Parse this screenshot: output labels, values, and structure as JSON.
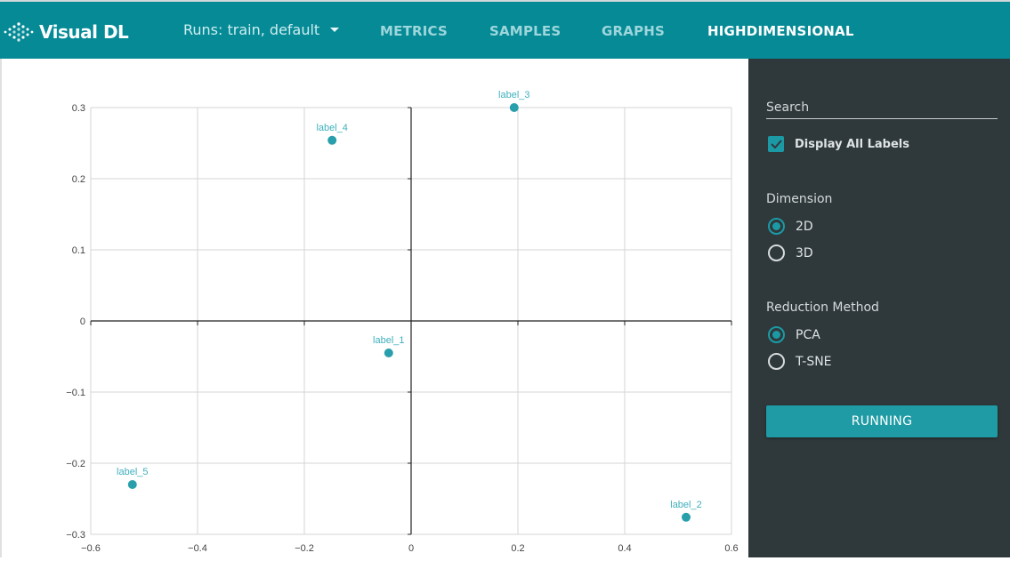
{
  "header": {
    "app_name": "Visual DL",
    "logo_icon": "dotted-diamond-icon",
    "runs_label": "Runs: train, default",
    "runs_icon": "caret-down-icon",
    "nav": [
      {
        "label": "METRICS",
        "active": false
      },
      {
        "label": "SAMPLES",
        "active": false
      },
      {
        "label": "GRAPHS",
        "active": false
      },
      {
        "label": "HIGHDIMENSIONAL",
        "active": true
      }
    ]
  },
  "sidebar": {
    "search_placeholder": "Search",
    "search_value": "",
    "display_all_labels": {
      "label": "Display All Labels",
      "checked": true
    },
    "dimension": {
      "title": "Dimension",
      "options": [
        {
          "label": "2D",
          "selected": true
        },
        {
          "label": "3D",
          "selected": false
        }
      ]
    },
    "reduction": {
      "title": "Reduction Method",
      "options": [
        {
          "label": "PCA",
          "selected": true
        },
        {
          "label": "T-SNE",
          "selected": false
        }
      ]
    },
    "run_button_label": "RUNNING"
  },
  "colors": {
    "header_bg": "#058a96",
    "sidebar_bg": "#2f393b",
    "accent": "#1e9ba4",
    "point": "#2a9fac",
    "point_label": "#3fb0bc"
  },
  "chart_data": {
    "type": "scatter",
    "title": "",
    "xlabel": "",
    "ylabel": "",
    "xlim": [
      -0.6,
      0.6
    ],
    "ylim": [
      -0.3,
      0.3
    ],
    "xticks": [
      -0.6,
      -0.4,
      -0.2,
      0,
      0.2,
      0.4,
      0.6
    ],
    "yticks": [
      -0.3,
      -0.2,
      -0.1,
      0,
      0.1,
      0.2,
      0.3
    ],
    "xtick_labels": [
      "−0.6",
      "−0.4",
      "−0.2",
      "0",
      "0.2",
      "0.4",
      "0.6"
    ],
    "ytick_labels": [
      "−0.3",
      "−0.2",
      "−0.1",
      "0",
      "0.1",
      "0.2",
      "0.3"
    ],
    "grid": true,
    "points": [
      {
        "label": "label_1",
        "x": -0.042,
        "y": -0.045
      },
      {
        "label": "label_2",
        "x": 0.515,
        "y": -0.276
      },
      {
        "label": "label_3",
        "x": 0.193,
        "y": 0.3
      },
      {
        "label": "label_4",
        "x": -0.148,
        "y": 0.254
      },
      {
        "label": "label_5",
        "x": -0.522,
        "y": -0.23
      }
    ]
  }
}
